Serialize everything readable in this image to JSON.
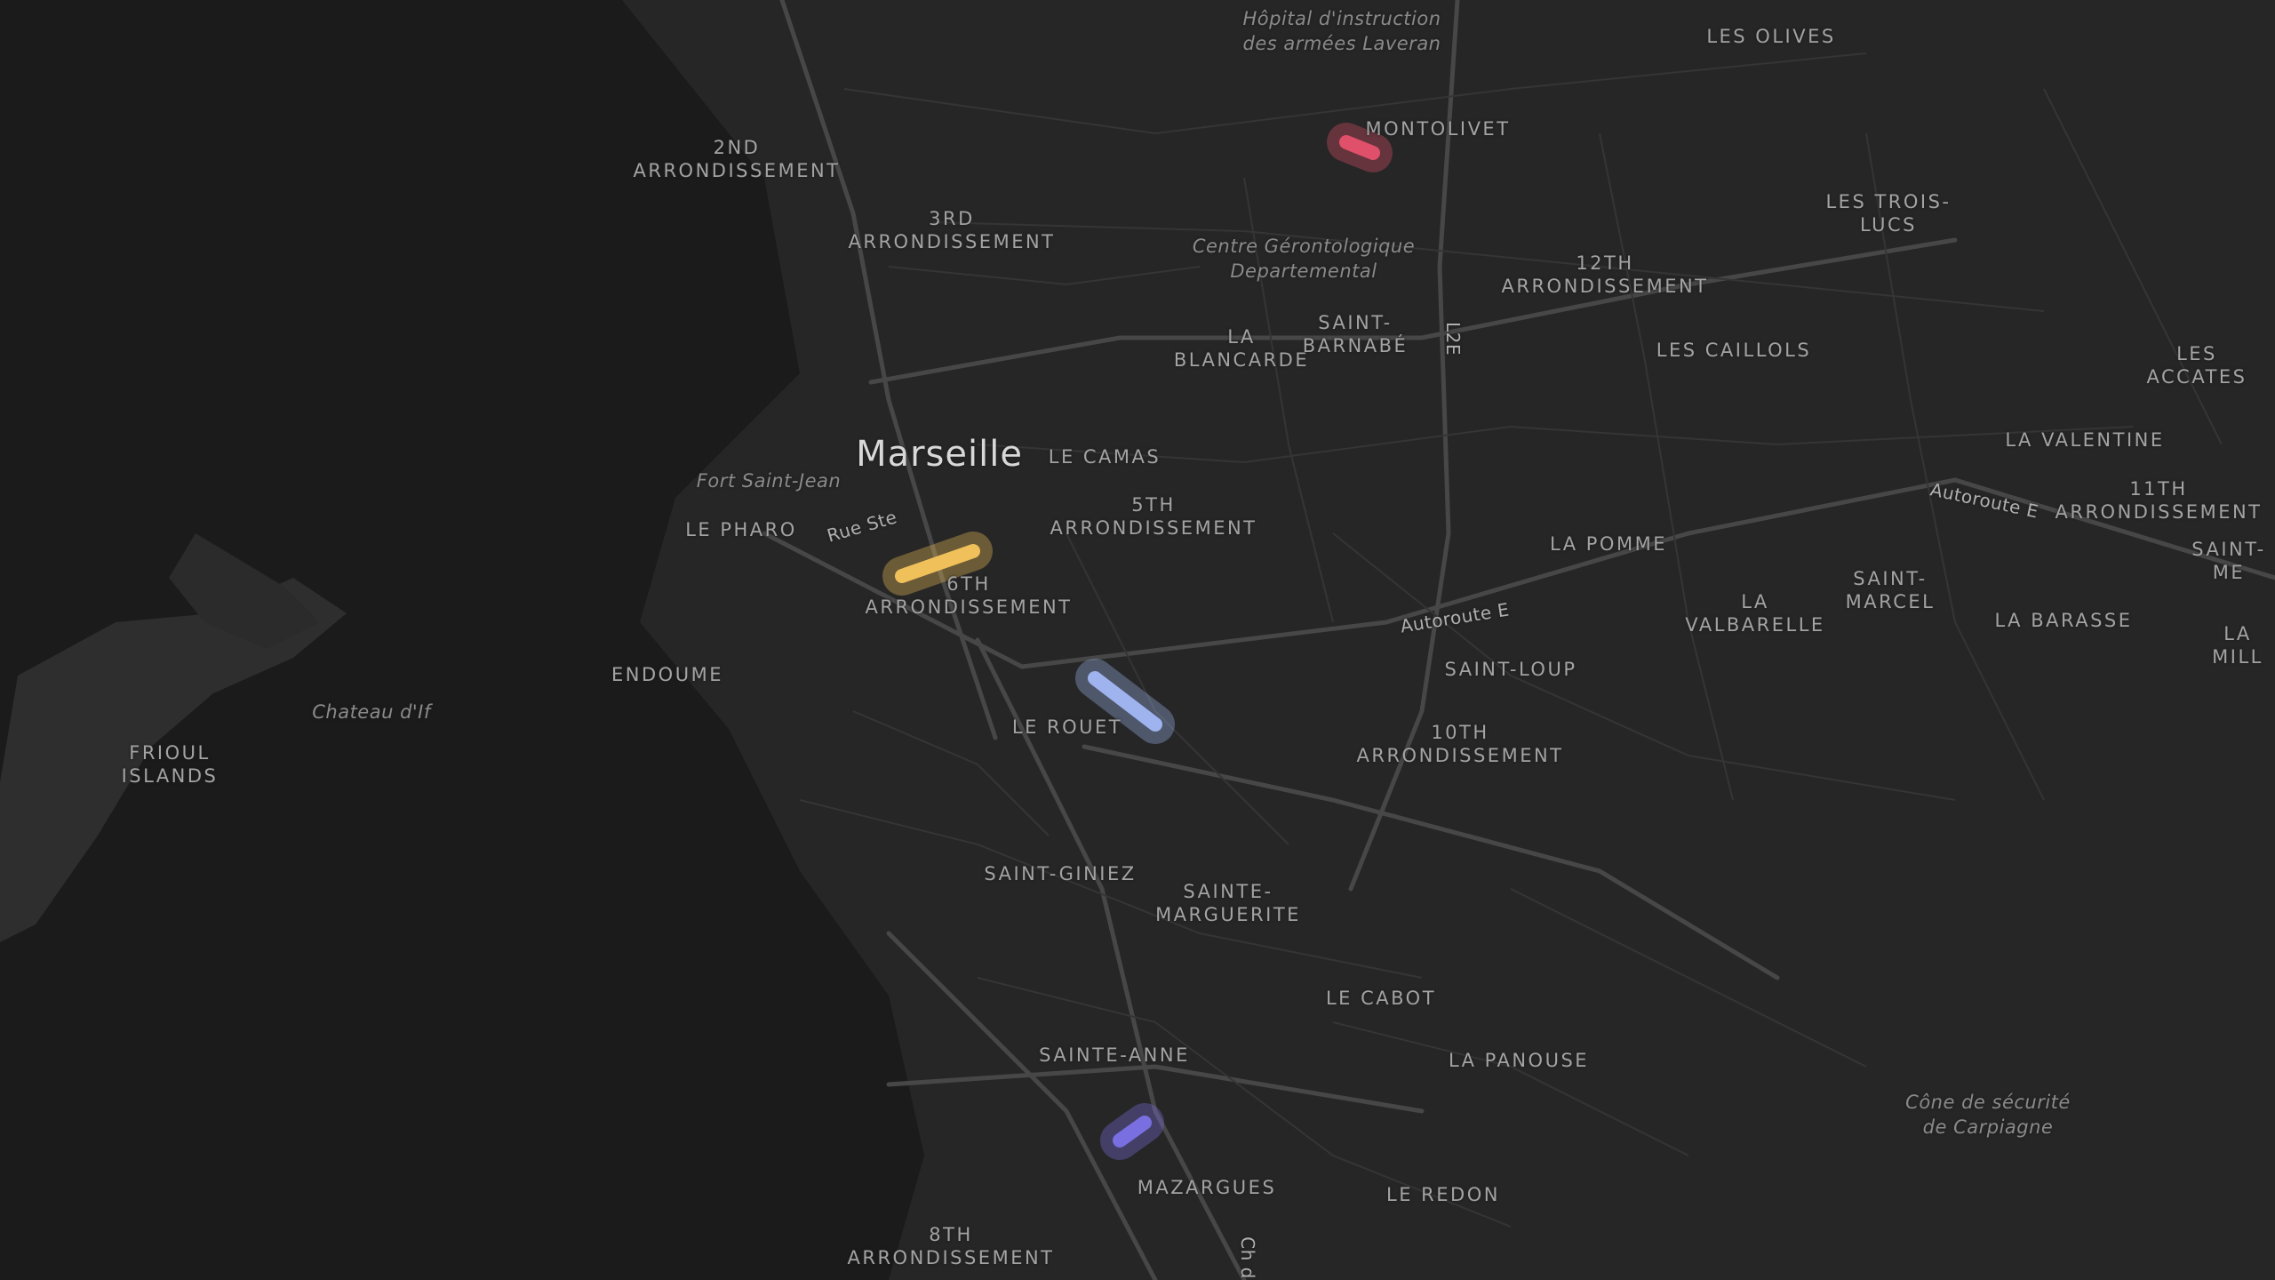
{
  "map": {
    "colors": {
      "land": "#262626",
      "water": "#1b1b1b",
      "road": "#3a3a3a",
      "major_road": "#474747",
      "label": "#a3a3a3"
    },
    "labels": [
      {
        "id": "2nd-arrondissement",
        "text": "2ND\nARRONDISSEMENT",
        "kind": "district"
      },
      {
        "id": "3rd-arrondissement",
        "text": "3RD\nARRONDISSEMENT",
        "kind": "district"
      },
      {
        "id": "hopital-laveran",
        "text": "Hôpital d'instruction\ndes armées Laveran",
        "kind": "poi"
      },
      {
        "id": "les-olives",
        "text": "LES OLIVES",
        "kind": "district"
      },
      {
        "id": "montolivet",
        "text": "MONTOLIVET",
        "kind": "district"
      },
      {
        "id": "les-trois-lucs",
        "text": "LES TROIS-\nLUCS",
        "kind": "district"
      },
      {
        "id": "centre-gerontologique",
        "text": "Centre Gérontologique\nDepartemental",
        "kind": "poi"
      },
      {
        "id": "12th-arrondissement",
        "text": "12TH\nARRONDISSEMENT",
        "kind": "district"
      },
      {
        "id": "la-blancarde",
        "text": "LA\nBLANCARDE",
        "kind": "district"
      },
      {
        "id": "saint-barnabe",
        "text": "SAINT-\nBARNABÉ",
        "kind": "district"
      },
      {
        "id": "l2e",
        "text": "L2E",
        "kind": "road"
      },
      {
        "id": "les-caillols",
        "text": "LES CAILLOLS",
        "kind": "district"
      },
      {
        "id": "les-accates",
        "text": "LES ACCATES",
        "kind": "district"
      },
      {
        "id": "marseille",
        "text": "Marseille",
        "kind": "city"
      },
      {
        "id": "le-camas",
        "text": "LE CAMAS",
        "kind": "district"
      },
      {
        "id": "fort-saint-jean",
        "text": "Fort Saint-Jean",
        "kind": "poi"
      },
      {
        "id": "la-valentine",
        "text": "LA VALENTINE",
        "kind": "district"
      },
      {
        "id": "5th-arrondissement",
        "text": "5TH\nARRONDISSEMENT",
        "kind": "district"
      },
      {
        "id": "autoroute-e-east",
        "text": "Autoroute E",
        "kind": "road"
      },
      {
        "id": "11th-arrondissement",
        "text": "11TH\nARRONDISSEMENT",
        "kind": "district"
      },
      {
        "id": "le-pharo",
        "text": "LE PHARO",
        "kind": "district"
      },
      {
        "id": "rue-ste",
        "text": "Rue Ste",
        "kind": "road"
      },
      {
        "id": "la-pomme",
        "text": "LA POMME",
        "kind": "district"
      },
      {
        "id": "saint-me",
        "text": "SAINT-ME",
        "kind": "district"
      },
      {
        "id": "6th-arrondissement",
        "text": "6TH\nARRONDISSEMENT",
        "kind": "district"
      },
      {
        "id": "la-valbarelle",
        "text": "LA\nVALBARELLE",
        "kind": "district"
      },
      {
        "id": "saint-marcel",
        "text": "SAINT-\nMARCEL",
        "kind": "district"
      },
      {
        "id": "la-barasse",
        "text": "LA BARASSE",
        "kind": "district"
      },
      {
        "id": "autoroute-e-center",
        "text": "Autoroute E",
        "kind": "road"
      },
      {
        "id": "la-mill",
        "text": "LA MILL",
        "kind": "district"
      },
      {
        "id": "endoume",
        "text": "ENDOUME",
        "kind": "district"
      },
      {
        "id": "saint-loup",
        "text": "SAINT-LOUP",
        "kind": "district"
      },
      {
        "id": "chateau-dif",
        "text": "Chateau d'If",
        "kind": "poi"
      },
      {
        "id": "le-rouet",
        "text": "LE ROUET",
        "kind": "district"
      },
      {
        "id": "10th-arrondissement",
        "text": "10TH\nARRONDISSEMENT",
        "kind": "district"
      },
      {
        "id": "frioul-islands",
        "text": "FRIOUL\nISLANDS",
        "kind": "district"
      },
      {
        "id": "saint-giniez",
        "text": "SAINT-GINIEZ",
        "kind": "district"
      },
      {
        "id": "sainte-marguerite",
        "text": "SAINTE-\nMARGUERITE",
        "kind": "district"
      },
      {
        "id": "le-cabot",
        "text": "LE CABOT",
        "kind": "district"
      },
      {
        "id": "sainte-anne",
        "text": "SAINTE-ANNE",
        "kind": "district"
      },
      {
        "id": "la-panouse",
        "text": "LA PANOUSE",
        "kind": "district"
      },
      {
        "id": "cone-de-securite",
        "text": "Cône de sécurité\nde Carpiagne",
        "kind": "poi"
      },
      {
        "id": "mazargues",
        "text": "MAZARGUES",
        "kind": "district"
      },
      {
        "id": "le-redon",
        "text": "LE REDON",
        "kind": "district"
      },
      {
        "id": "8th-arrondissement",
        "text": "8TH\nARRONDISSEMENT",
        "kind": "district"
      },
      {
        "id": "ch-d",
        "text": "Ch d",
        "kind": "road"
      }
    ],
    "markers": [
      {
        "id": "red",
        "color": "#e0506a"
      },
      {
        "id": "yellow",
        "color": "#f0c05a"
      },
      {
        "id": "blue",
        "color": "#9fb4ef"
      },
      {
        "id": "purple",
        "color": "#7a6fe0"
      }
    ]
  }
}
